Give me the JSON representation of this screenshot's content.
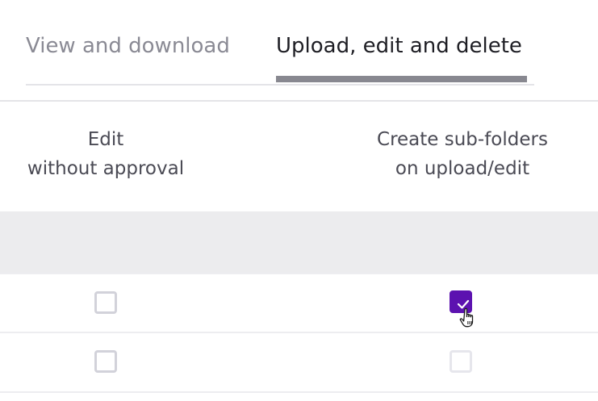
{
  "tabs": [
    {
      "label": "View and download",
      "active": false
    },
    {
      "label": "Upload, edit and delete",
      "active": true
    }
  ],
  "columns": {
    "edit": {
      "line1": "Edit",
      "line2": "without approval"
    },
    "subfolders": {
      "line1": "Create sub-folders",
      "line2": "on upload/edit"
    }
  },
  "rows": [
    {
      "edit_without_approval": false,
      "create_sub_folders": true
    },
    {
      "edit_without_approval": false,
      "create_sub_folders": false
    }
  ],
  "colors": {
    "accent": "#5c12b0",
    "tab_underline": "#888890",
    "group_band": "#ececee"
  },
  "icons": {
    "check": "check-icon",
    "cursor": "hand-pointer-cursor-icon"
  }
}
